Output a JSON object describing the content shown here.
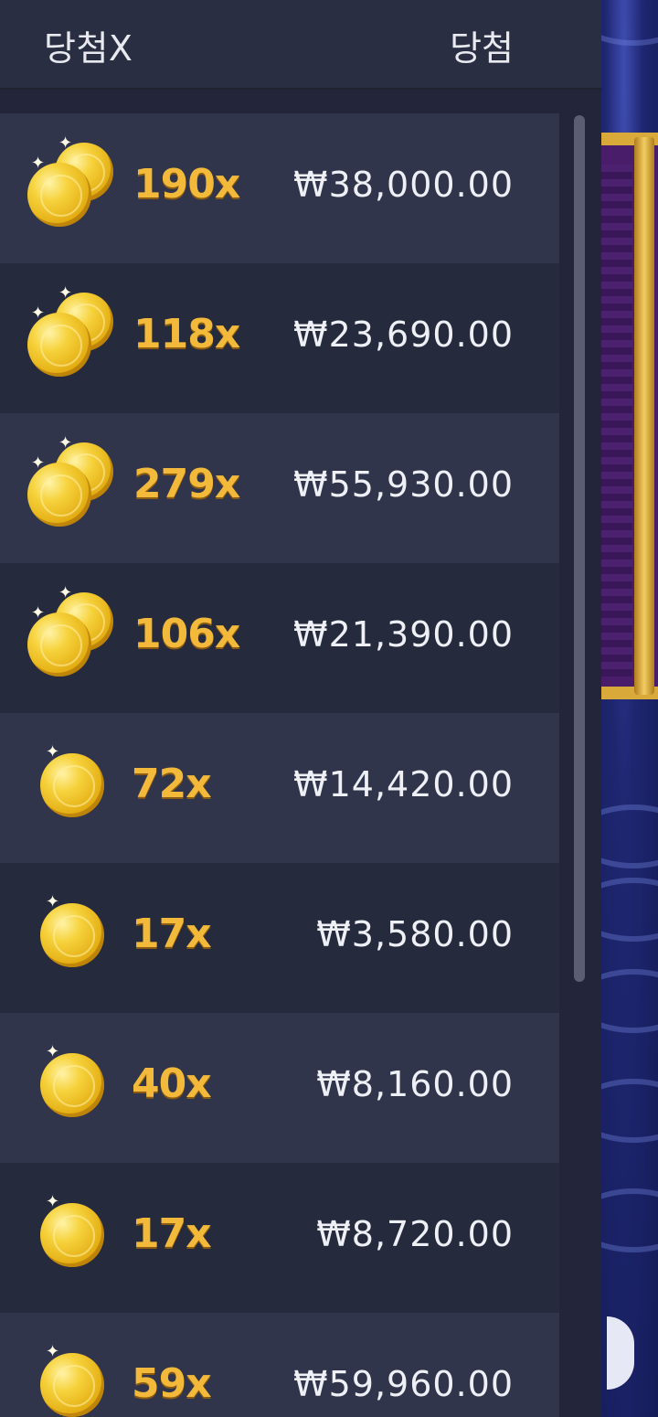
{
  "header": {
    "multiplier_col": "당첨X",
    "win_col": "당첨"
  },
  "rows": [
    {
      "multiplier": "190x",
      "amount": "₩38,000.00",
      "coins": "double"
    },
    {
      "multiplier": "118x",
      "amount": "₩23,690.00",
      "coins": "double"
    },
    {
      "multiplier": "279x",
      "amount": "₩55,930.00",
      "coins": "double"
    },
    {
      "multiplier": "106x",
      "amount": "₩21,390.00",
      "coins": "double"
    },
    {
      "multiplier": "72x",
      "amount": "₩14,420.00",
      "coins": "single"
    },
    {
      "multiplier": "17x",
      "amount": "₩3,580.00",
      "coins": "single"
    },
    {
      "multiplier": "40x",
      "amount": "₩8,160.00",
      "coins": "single"
    },
    {
      "multiplier": "17x",
      "amount": "₩8,720.00",
      "coins": "single"
    },
    {
      "multiplier": "59x",
      "amount": "₩59,960.00",
      "coins": "single"
    }
  ],
  "colors": {
    "multiplier": "#f3b93a",
    "row_light": "#31354b",
    "row_dark": "#262a3d"
  },
  "icons": {
    "coin": "gold-coin-icon",
    "coins": "gold-coins-icon"
  }
}
